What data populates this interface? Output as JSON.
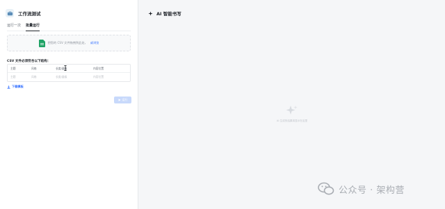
{
  "app": {
    "title": "工作流测试"
  },
  "tabs": [
    {
      "label": "运行一次",
      "active": false
    },
    {
      "label": "批量运行",
      "active": true
    }
  ],
  "upload": {
    "text": "把您的 CSV 文件拖拽到此处，",
    "link": "或浏览"
  },
  "csv": {
    "label": "CSV 文件必须符合以下结构：",
    "headers": [
      "主题",
      "风格",
      "长度/量级",
      "内容位置"
    ],
    "placeholders": [
      "主题",
      "风格",
      "长度/量级",
      "内容位置"
    ]
  },
  "download": {
    "label": "下载模板"
  },
  "run_button": {
    "label": "运行"
  },
  "right_panel": {
    "title": "AI 智能书写",
    "empty_text": "AI 生成的结果将显示在这里"
  },
  "watermark": {
    "text": "公众号 · 架构营"
  },
  "colors": {
    "accent": "#3370ff",
    "run_disabled": "#c8d9fb"
  }
}
